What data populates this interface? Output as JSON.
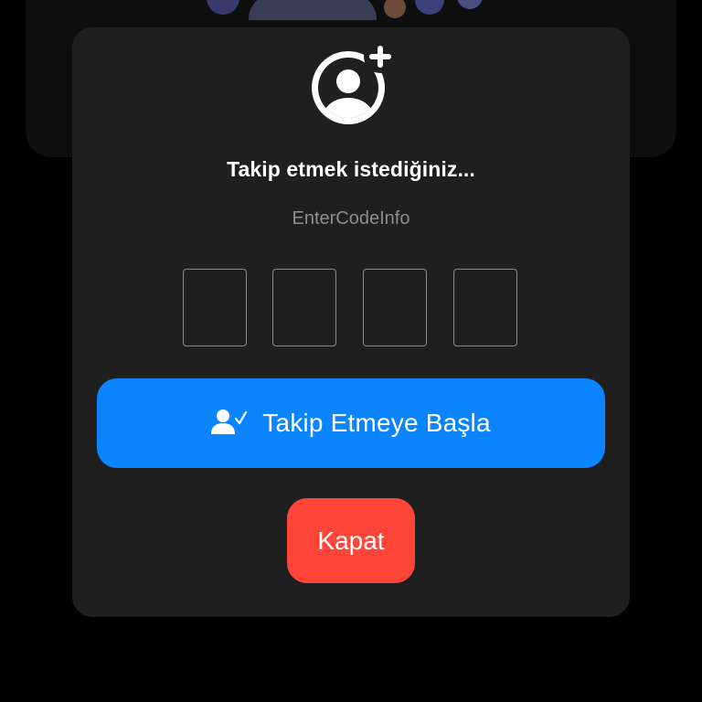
{
  "modal": {
    "icon": "person-add-icon",
    "title": "Takip etmek istediğiniz...",
    "subtitle": "EnterCodeInfo",
    "code_inputs": [
      "",
      "",
      "",
      ""
    ],
    "primary_button": {
      "label": "Takip Etmeye Başla",
      "icon": "person-check-icon"
    },
    "close_button": {
      "label": "Kapat"
    }
  },
  "colors": {
    "background": "#000000",
    "modal_background": "#1f1f20",
    "primary_blue": "#0a84ff",
    "close_red": "#ff453a",
    "subtitle_gray": "#8d8d92",
    "input_border": "#8a8a8e"
  }
}
